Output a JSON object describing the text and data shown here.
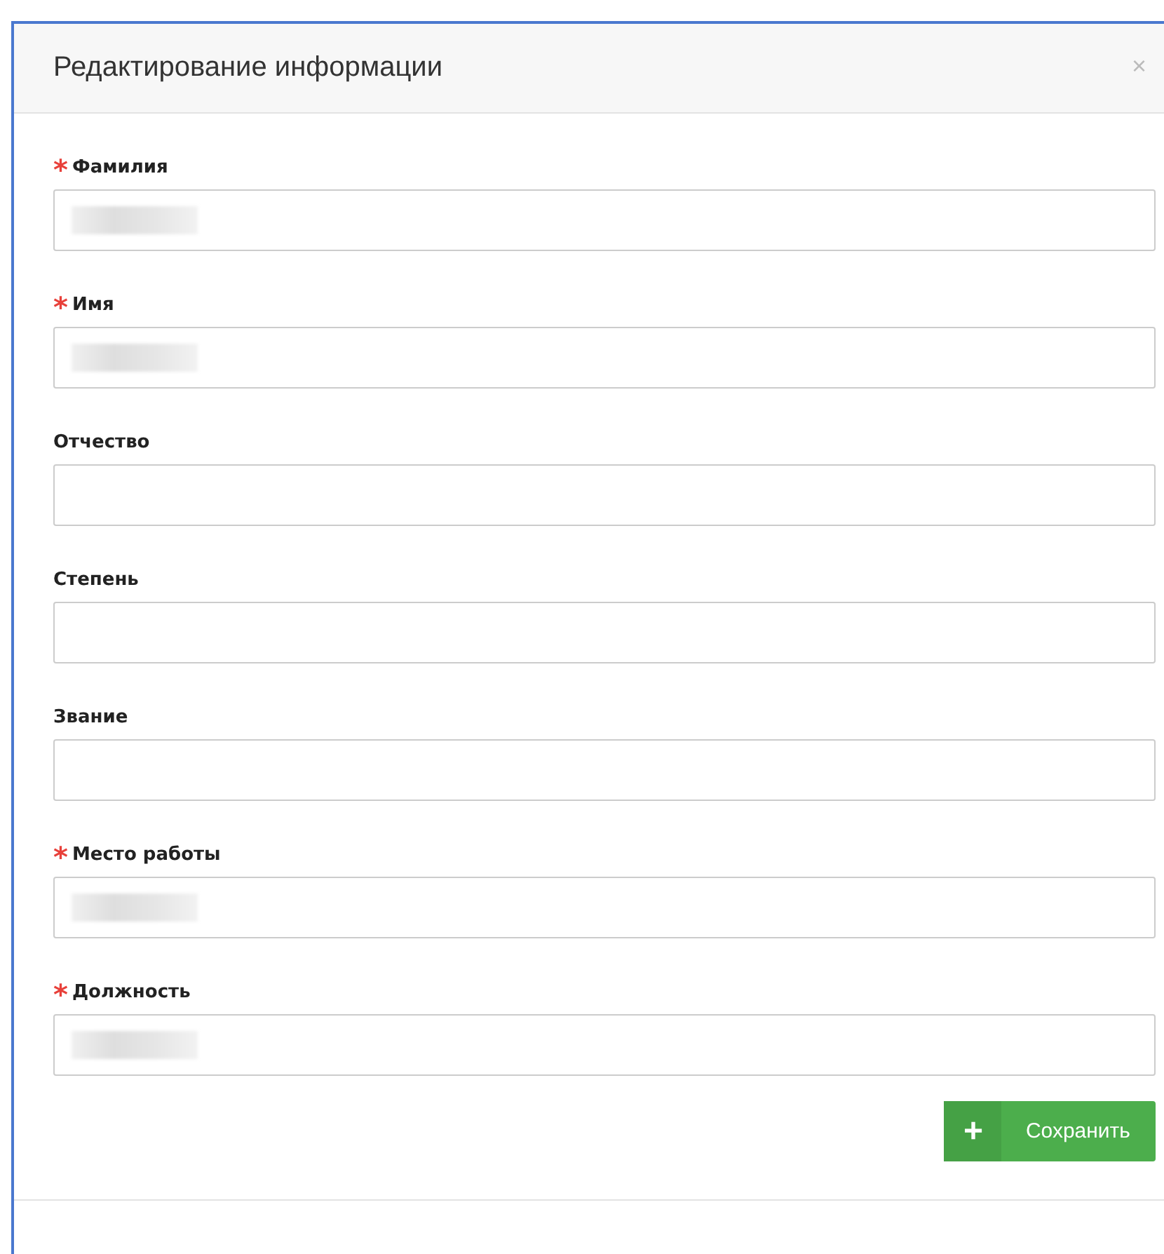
{
  "dialog": {
    "title": "Редактирование информации",
    "close": "×"
  },
  "fields": [
    {
      "label": "Фамилия",
      "required_mark": "*",
      "redacted": true
    },
    {
      "label": "Имя",
      "required_mark": "*",
      "redacted": true
    },
    {
      "label": "Отчество",
      "redacted": false
    },
    {
      "label": "Степень",
      "redacted": false
    },
    {
      "label": "Звание",
      "redacted": false
    },
    {
      "label": "Место работы",
      "required_mark": "*",
      "redacted": true
    },
    {
      "label": "Должность",
      "required_mark": "*",
      "redacted": true
    }
  ],
  "save_button": {
    "icon": "+",
    "label": "Сохранить"
  }
}
